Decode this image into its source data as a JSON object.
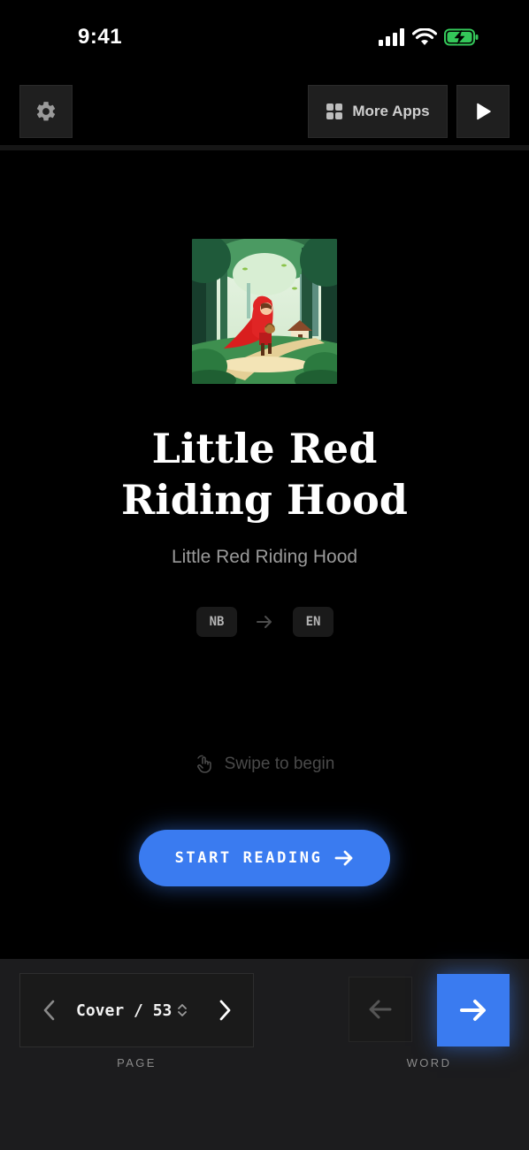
{
  "status_bar": {
    "time": "9:41"
  },
  "topbar": {
    "more_apps_label": "More Apps"
  },
  "book": {
    "title_line1": "Little Red",
    "title_line2": "Riding Hood",
    "subtitle": "Little Red Riding Hood",
    "source_lang": "NB",
    "target_lang": "EN"
  },
  "swipe_hint": "Swipe to begin",
  "start_button_label": "START READING",
  "bottom": {
    "page_indicator": "Cover / 53",
    "page_caption": "PAGE",
    "word_caption": "WORD"
  },
  "colors": {
    "accent": "#3a7bf0",
    "battery": "#34c759"
  },
  "icons": [
    "signal-icon",
    "wifi-icon",
    "battery-charging-icon",
    "gear-icon",
    "grid-icon",
    "play-icon",
    "arrow-right-icon",
    "hand-swipe-icon",
    "chevron-left-icon",
    "chevron-right-icon",
    "chevron-up-down-icon",
    "arrow-left-icon"
  ]
}
